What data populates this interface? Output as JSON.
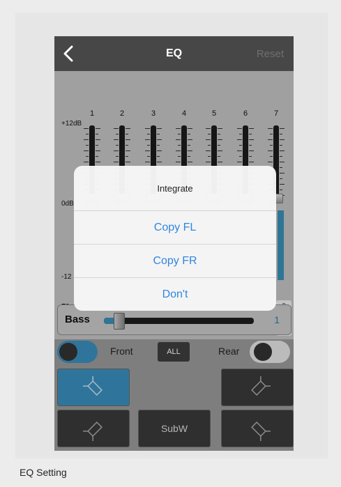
{
  "nav": {
    "title": "EQ",
    "reset_label": "Reset"
  },
  "eq": {
    "db_top": "+12dB",
    "db_mid": "0dB",
    "db_bottom": "-12",
    "bands": [
      "1",
      "2",
      "3",
      "4",
      "5",
      "6",
      "7"
    ],
    "f0_label": "F0",
    "q_label": "Q",
    "band7_f0_value": "0",
    "band7_q_value": "0 +"
  },
  "bass": {
    "label": "Bass",
    "value": "1",
    "level_fraction": 0.06
  },
  "channels": {
    "front_label": "Front",
    "all_label": "ALL",
    "rear_label": "Rear",
    "front_on": true,
    "rear_on": false
  },
  "speakers": {
    "subw_label": "SubW"
  },
  "dialog": {
    "title": "Integrate",
    "options": [
      "Copy FL",
      "Copy FR",
      "Don't"
    ]
  },
  "caption": "EQ Setting",
  "colors": {
    "accent": "#3a8fbd",
    "link": "#2f86e0",
    "navbar": "#474747"
  }
}
